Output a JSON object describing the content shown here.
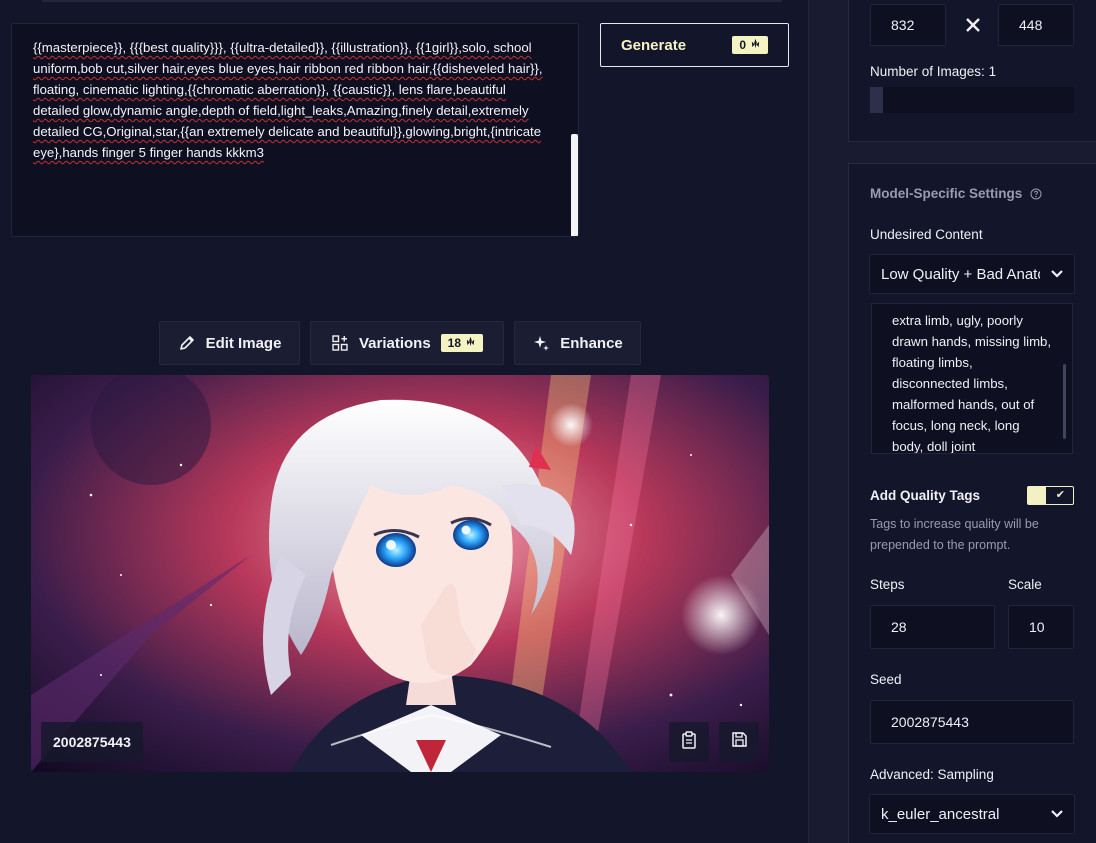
{
  "prompt": {
    "text": "{{masterpiece}}, {{{best quality}}}, {{ultra-detailed}}, {{illustration}}, {{1girl}},solo, school uniform,bob cut,silver hair,eyes blue eyes,hair ribbon red ribbon hair,{{disheveled hair}}, floating,  cinematic lighting,{{chromatic aberration}}, {{caustic}}, lens flare,beautiful detailed glow,dynamic angle,depth of field,light_leaks,Amazing,finely detail,extremely detailed CG,Original,star,{{an extremely delicate and beautiful}},glowing,bright,{intricate eye},hands finger 5 finger hands kkkm3"
  },
  "generate": {
    "label": "Generate",
    "cost": "0"
  },
  "toolbar": {
    "edit_image": "Edit Image",
    "variations": "Variations",
    "variations_cost": "18",
    "enhance": "Enhance"
  },
  "image": {
    "seed_label": "2002875443",
    "description_colors": {
      "bg": "#2a1b3d",
      "hair": "#e6e4ef",
      "eyes": "#2ea8ff",
      "accent": "#ff3c6e"
    }
  },
  "size": {
    "width": "832",
    "height": "448"
  },
  "number_of_images": {
    "label": "Number of Images:",
    "value": "1",
    "fraction": 0.06
  },
  "model_settings": {
    "title": "Model-Specific Settings",
    "undesired_content_label": "Undesired Content",
    "undesired_preset": "Low Quality + Bad Anatomy",
    "undesired_text": "extra limb, ugly, poorly drawn hands, missing limb, floating limbs, disconnected limbs, malformed hands, out of focus, long neck, long body, doll joint",
    "quality_tags_label": "Add Quality Tags",
    "quality_tags_on": true,
    "quality_tags_desc": "Tags to increase quality will be prepended to the prompt.",
    "steps_label": "Steps",
    "steps_value": "28",
    "scale_label": "Scale",
    "scale_value": "10",
    "seed_label": "Seed",
    "seed_value": "2002875443",
    "sampling_label": "Advanced: Sampling",
    "sampling_value": "k_euler_ancestral"
  },
  "colors": {
    "accent": "#f5f3c2",
    "bg": "#13152a",
    "input_bg": "#0e0f21"
  }
}
